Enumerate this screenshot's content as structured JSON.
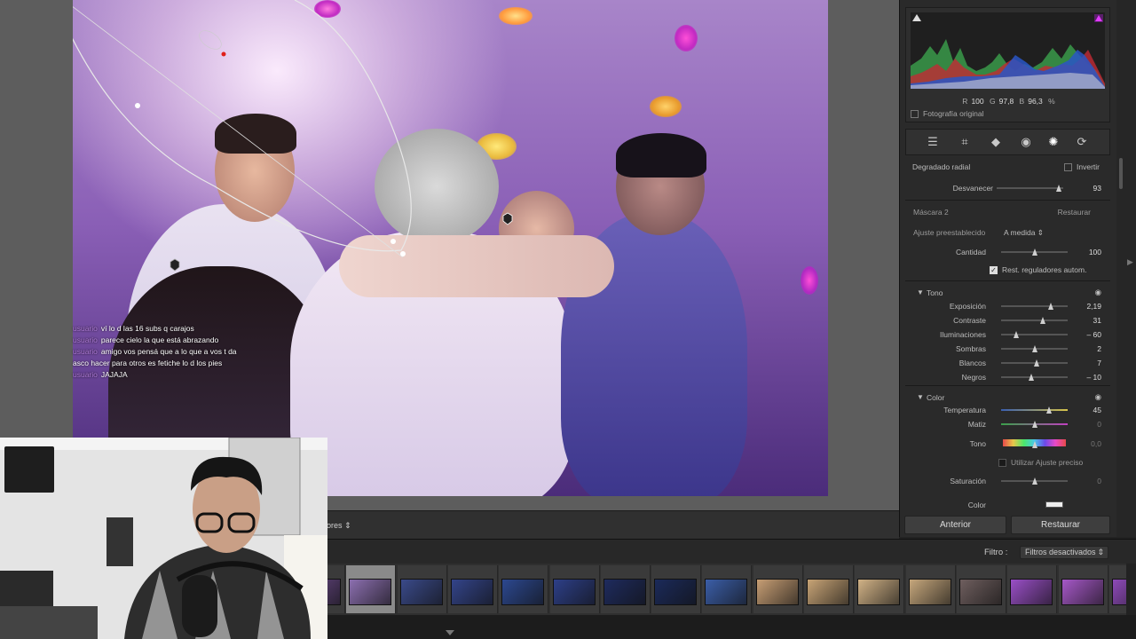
{
  "chat": [
    {
      "user": "usuario",
      "message": "ví lo d las 16 subs q carajos"
    },
    {
      "user": "usuario",
      "message": "parece cielo la que está abrazando"
    },
    {
      "user": "usuario",
      "message": "amigo vos pensá que a lo que a vos t da asco hacer para otros es fetiche lo d los pies"
    },
    {
      "user": "usuario",
      "message": "JAJAJA"
    }
  ],
  "toolbar": {
    "label": "ores",
    "arrow": "⇕"
  },
  "histogram": {
    "r_label": "R",
    "r_value": "100",
    "g_label": "G",
    "g_value": "97,8",
    "b_label": "B",
    "b_value": "96,3",
    "unit": "%",
    "original_photo_label": "Fotografía original"
  },
  "tools": [
    "sliders-icon",
    "crop-icon",
    "eraser-icon",
    "redeye-icon",
    "mask-icon",
    "reset-icon"
  ],
  "radial": {
    "title": "Degradado radial",
    "invert_label": "Invertir",
    "feather_label": "Desvanecer",
    "feather_value": "93",
    "feather_pos": 0.93
  },
  "mask": {
    "title": "Máscara 2",
    "restore_label": "Restaurar",
    "preset_label": "Ajuste preestablecido",
    "preset_value": "A medida",
    "amount_label": "Cantidad",
    "amount_value": "100",
    "amount_pos": 0.5,
    "auto_reset_label": "Rest. reguladores autom."
  },
  "tone": {
    "title": "Tono",
    "sliders": [
      {
        "label": "Exposición",
        "value": "2,19",
        "pos": 0.75
      },
      {
        "label": "Contraste",
        "value": "31",
        "pos": 0.63
      },
      {
        "label": "Iluminaciones",
        "value": "– 60",
        "pos": 0.22
      },
      {
        "label": "Sombras",
        "value": "2",
        "pos": 0.51
      },
      {
        "label": "Blancos",
        "value": "7",
        "pos": 0.53
      },
      {
        "label": "Negros",
        "value": "– 10",
        "pos": 0.45
      }
    ]
  },
  "color": {
    "title": "Color",
    "temperature_label": "Temperatura",
    "temperature_value": "45",
    "temperature_pos": 0.72,
    "tint_label": "Matiz",
    "tint_value": "0",
    "tint_pos": 0.5,
    "hue_label": "Tono",
    "hue_value": "0,0",
    "hue_pos": 0.5,
    "fine_adjust_label": "Utilizar Ajuste preciso",
    "saturation_label": "Saturación",
    "saturation_value": "0",
    "saturation_pos": 0.5,
    "color_label": "Color"
  },
  "buttons": {
    "previous": "Anterior",
    "restore": "Restaurar"
  },
  "filmstrip": {
    "filter_label": "Filtro :",
    "filter_value": "Filtros desactivados",
    "thumbs": [
      {
        "color": "#6b4a8a",
        "sel": false
      },
      {
        "color": "#8c6fb0",
        "sel": true
      },
      {
        "color": "#3a4a8a",
        "sel": false
      },
      {
        "color": "#33448a",
        "sel": false
      },
      {
        "color": "#2c4890",
        "sel": false
      },
      {
        "color": "#2d3f88",
        "sel": false
      },
      {
        "color": "#1e2b5e",
        "sel": false
      },
      {
        "color": "#1b2a5a",
        "sel": false
      },
      {
        "color": "#3b5ea8",
        "sel": false
      },
      {
        "color": "#c79e74",
        "sel": false
      },
      {
        "color": "#c8a476",
        "sel": false
      },
      {
        "color": "#d1b286",
        "sel": false
      },
      {
        "color": "#c6a77c",
        "sel": false
      },
      {
        "color": "#6e5e5e",
        "sel": false
      },
      {
        "color": "#9a4fc7",
        "sel": false
      },
      {
        "color": "#a658c8",
        "sel": false
      },
      {
        "color": "#8d4ab8",
        "sel": false
      }
    ]
  }
}
